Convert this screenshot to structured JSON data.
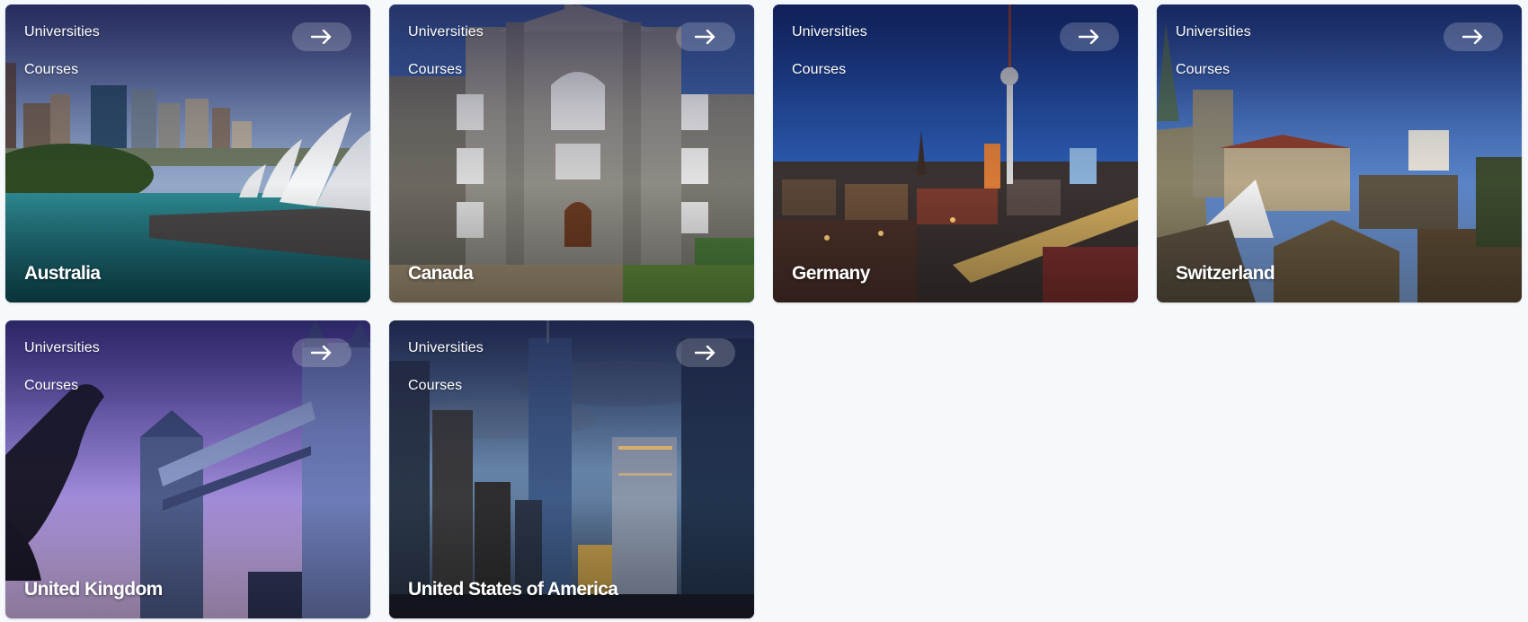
{
  "cards": [
    {
      "country": "Australia",
      "universities_label": "Universities",
      "courses_label": "Courses"
    },
    {
      "country": "Canada",
      "universities_label": "Universities",
      "courses_label": "Courses"
    },
    {
      "country": "Germany",
      "universities_label": "Universities",
      "courses_label": "Courses"
    },
    {
      "country": "Switzerland",
      "universities_label": "Universities",
      "courses_label": "Courses"
    },
    {
      "country": "United Kingdom",
      "universities_label": "Universities",
      "courses_label": "Courses"
    },
    {
      "country": "United States of America",
      "universities_label": "Universities",
      "courses_label": "Courses"
    }
  ],
  "icons": {
    "arrow": "arrow-right-icon"
  },
  "colors": {
    "page_bg": "#f6f9fc",
    "text": "#ffffff"
  },
  "scenes": {
    "australia": "harbour city skyline with opera house sails",
    "canada": "stone university building, Saint Mary's University",
    "germany": "night city with TV tower",
    "switzerland": "old town rooftops and church spire",
    "united_kingdom": "Tower Bridge at dusk",
    "usa": "city skyscrapers at dusk"
  }
}
